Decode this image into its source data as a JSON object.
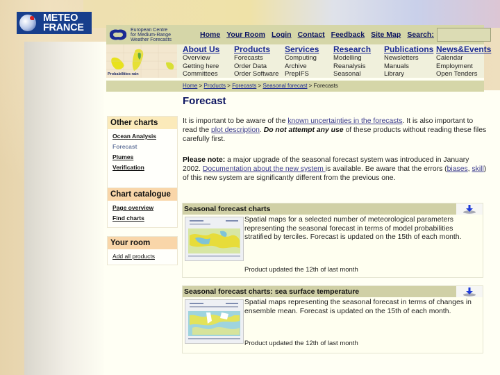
{
  "brand": {
    "meteo_france_line1": "METEO",
    "meteo_france_line2": "FRANCE",
    "ecmwf_line1": "European Centre",
    "ecmwf_line2": "for Medium-Range",
    "ecmwf_line3": "Weather Forecasts",
    "map_caption": "Probabilities rain"
  },
  "topnav": {
    "items": [
      "Home",
      "Your Room",
      "Login",
      "Contact",
      "Feedback",
      "Site Map"
    ],
    "search_label": "Search:",
    "search_value": ""
  },
  "menu": [
    {
      "head": "About Us",
      "items": [
        "Overview",
        "Getting here",
        "Committees"
      ]
    },
    {
      "head": "Products",
      "items": [
        "Forecasts",
        "Order Data",
        "Order Software"
      ]
    },
    {
      "head": "Services",
      "items": [
        "Computing",
        "Archive",
        "PrepIFS"
      ]
    },
    {
      "head": "Research",
      "items": [
        "Modelling",
        "Reanalysis",
        "Seasonal"
      ]
    },
    {
      "head": "Publications",
      "items": [
        "Newsletters",
        "Manuals",
        "Library"
      ]
    },
    {
      "head": "News&Events",
      "items": [
        "Calendar",
        "Employment",
        "Open Tenders"
      ]
    }
  ],
  "breadcrumb": {
    "items": [
      "Home",
      "Products",
      "Forecasts",
      "Seasonal forecast"
    ],
    "current": "Forecasts",
    "separator": ">"
  },
  "page_title": "Forecast",
  "sidebar": {
    "other_charts": {
      "title": "Other charts",
      "links": [
        "Ocean Analysis",
        "Forecast",
        "Plumes",
        "Verification"
      ],
      "current": "Forecast"
    },
    "chart_catalogue": {
      "title": "Chart catalogue",
      "links": [
        "Page overview",
        "Find charts"
      ]
    },
    "your_room": {
      "title": "Your room",
      "links": [
        "Add all products"
      ]
    }
  },
  "intro": {
    "p1_a": "It is important to be aware of the ",
    "p1_link1": "known uncertainties in the forecasts",
    "p1_b": ". It is also important to read the ",
    "p1_link2": "plot description",
    "p1_c": ". ",
    "p1_bold": "Do not attempt any use",
    "p1_d": " of these products without reading these files carefully first.",
    "p2_bold": "Please note:",
    "p2_a": " a major upgrade of the seasonal forecast system was introduced in January 2002. ",
    "p2_link1": "Documentation about the new system ",
    "p2_b": "is available. Be aware that the errors (",
    "p2_link2": "biases",
    "p2_c": ", ",
    "p2_link3": "skill",
    "p2_d": ") of this new system are significantly different from the previous one."
  },
  "panels": [
    {
      "title": "Seasonal forecast charts",
      "description": "Spatial maps for a selected number of meteorological parameters representing the seasonal forecast in terms of model probabilities stratified by terciles. Forecast is updated on the 15th of each month.",
      "updated": "Product updated the 12th of last month"
    },
    {
      "title": "Seasonal forecast charts: sea surface temperature",
      "description": "Spatial maps representing the seasonal forecast in terms of changes in ensemble mean. Forecast is updated on the 15th of each month.",
      "updated": "Product updated the 12th of last month"
    }
  ],
  "icons": {
    "download": "download-arrow-icon",
    "logo": "meteo-france-globe-icon"
  },
  "colors": {
    "nav_bar": "#d5d6a8",
    "menu_bg": "#f0f0dc",
    "link_blue": "#1b2a93",
    "title_navy": "#0c1460",
    "side_yellow": "#fbeaba",
    "side_orange": "#f9d6a9",
    "meteo_blue": "#173e8c"
  }
}
